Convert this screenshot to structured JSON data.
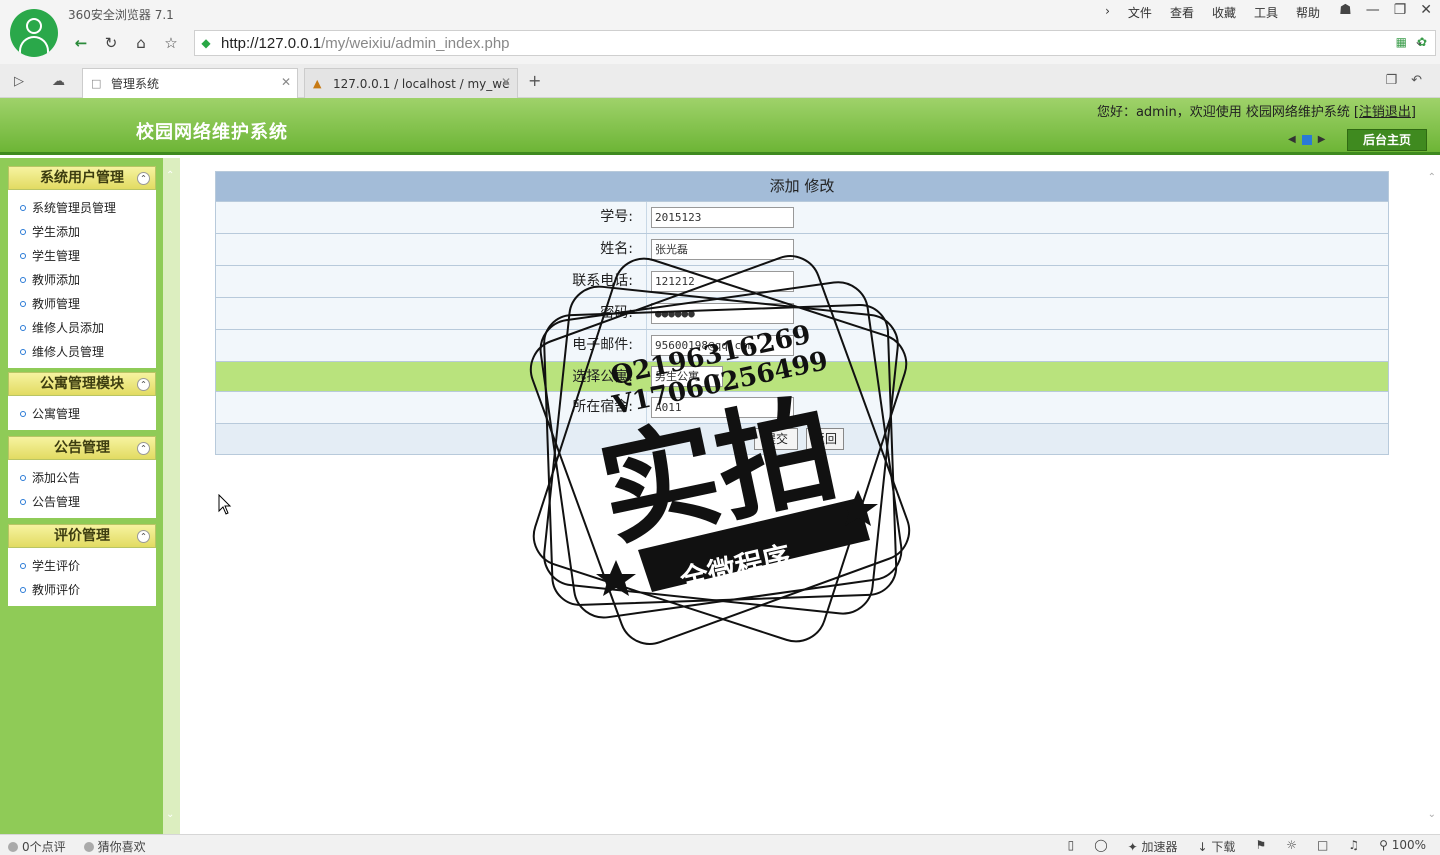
{
  "browser": {
    "title": "360安全浏览器 7.1",
    "menu": [
      "文件",
      "查看",
      "收藏",
      "工具",
      "帮助"
    ],
    "url_host": "http://127.0.0.1",
    "url_path": "/my/weixiu/admin_index.php",
    "tabs": [
      {
        "label": "管理系统",
        "active": true
      },
      {
        "label": "127.0.0.1 / localhost / my_we",
        "active": false
      }
    ],
    "status_left": [
      "0个点评",
      "猜你喜欢"
    ],
    "status_accelerator": "加速器",
    "status_download": "下载",
    "zoom": "100%"
  },
  "app": {
    "title": "校园网络维护系统",
    "welcome": "您好：admin，欢迎使用 校园网络维护系统",
    "logout": "[注销退出]",
    "home_button": "后台主页"
  },
  "sidebar": {
    "groups": [
      {
        "title": "系统用户管理",
        "items": [
          "系统管理员管理",
          "学生添加",
          "学生管理",
          "教师添加",
          "教师管理",
          "维修人员添加",
          "维修人员管理"
        ]
      },
      {
        "title": "公寓管理模块",
        "items": [
          "公寓管理"
        ]
      },
      {
        "title": "公告管理",
        "items": [
          "添加公告",
          "公告管理"
        ]
      },
      {
        "title": "评价管理",
        "items": [
          "学生评价",
          "教师评价"
        ]
      }
    ]
  },
  "form": {
    "header": "添加 修改",
    "fields": [
      {
        "label": "学号:",
        "value": "2015123"
      },
      {
        "label": "姓名:",
        "value": "张光磊"
      },
      {
        "label": "联系电话:",
        "value": "121212"
      },
      {
        "label": "密码:",
        "value": "●●●●●●"
      },
      {
        "label": "电子邮件:",
        "value": "95600198@qq.com"
      },
      {
        "label": "选择公寓:",
        "value": "男生公寓"
      },
      {
        "label": "所在宿舍:",
        "value": "A011"
      }
    ],
    "buttons": [
      "提交",
      "返回"
    ]
  },
  "watermark": {
    "line1": "Q2196316269",
    "line2": "V17060256499",
    "big": "实拍",
    "banner": "全微程序"
  }
}
